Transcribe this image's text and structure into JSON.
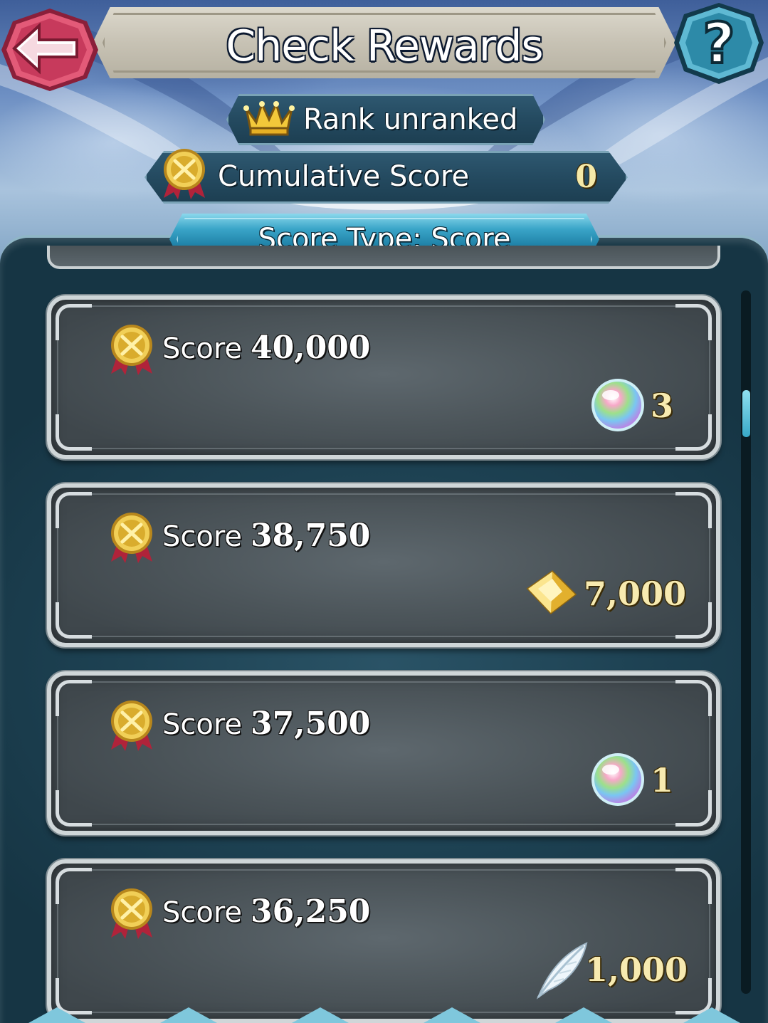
{
  "header": {
    "title": "Check Rewards"
  },
  "rank": {
    "label": "Rank  unranked"
  },
  "cumulative": {
    "label": "Cumulative Score",
    "value": "0"
  },
  "score_type": {
    "label": "Score Type: Score"
  },
  "rewards": [
    {
      "score_word": "Score",
      "score": "40,000",
      "reward_icon": "orb-icon",
      "quantity": "3"
    },
    {
      "score_word": "Score",
      "score": "38,750",
      "reward_icon": "crystal-icon",
      "quantity": "7,000"
    },
    {
      "score_word": "Score",
      "score": "37,500",
      "reward_icon": "orb-icon",
      "quantity": "1"
    },
    {
      "score_word": "Score",
      "score": "36,250",
      "reward_icon": "feather-icon",
      "quantity": "1,000"
    }
  ],
  "colors": {
    "panel": "#1d4152",
    "card": "#4c555a",
    "accent_tab": "#1d7ea4",
    "gold_text": "#f7eab0",
    "back_button": "#d94b6a",
    "help_button": "#2f8aa8"
  }
}
